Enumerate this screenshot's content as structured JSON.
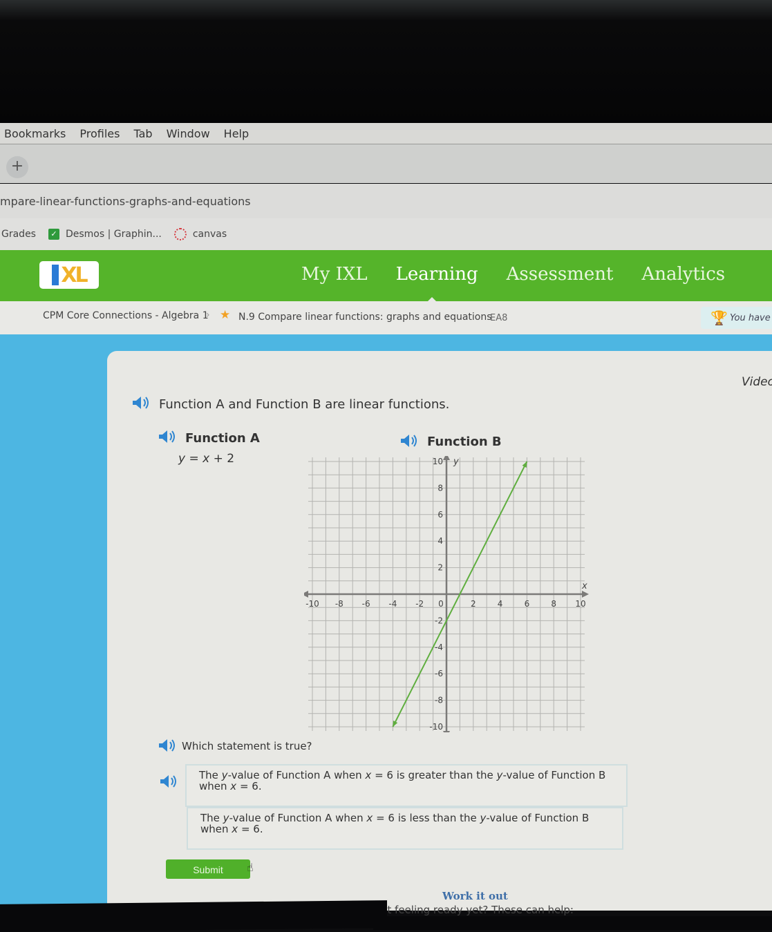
{
  "menubar": {
    "items": [
      "Bookmarks",
      "Profiles",
      "Tab",
      "Window",
      "Help"
    ]
  },
  "tabbar": {
    "new_tab_label": "+"
  },
  "address_bar": {
    "url": "mpare-linear-functions-graphs-and-equations"
  },
  "bookmarks": [
    {
      "label": "Grades",
      "icon": "none"
    },
    {
      "label": "Desmos | Graphin...",
      "icon": "desmos-icon"
    },
    {
      "label": "canvas",
      "icon": "canvas-icon"
    }
  ],
  "ixl_nav": {
    "logo": "IXL",
    "items": [
      "My IXL",
      "Learning",
      "Assessment",
      "Analytics"
    ],
    "active": "Learning"
  },
  "breadcrumb": {
    "course": "CPM Core Connections - Algebra 1",
    "skill": "N.9 Compare linear functions: graphs and equations",
    "code": "EA8",
    "award_text": "You have"
  },
  "card": {
    "video_link": "Video",
    "intro": "Function A and Function B are linear functions.",
    "function_a_label": "Function A",
    "function_a_eq": {
      "lhs": "y",
      "rhs_var": "x",
      "rhs_rest": " + 2"
    },
    "function_b_label": "Function B",
    "question": "Which statement is true?",
    "options": [
      {
        "pre": "The ",
        "v1": "y",
        "mid1": "-value of Function A when ",
        "v2": "x",
        "mid2": " = 6 is greater than the ",
        "v3": "y",
        "mid3": "-value of Function B when ",
        "v4": "x",
        "post": " = 6."
      },
      {
        "pre": "The ",
        "v1": "y",
        "mid1": "-value of Function A when ",
        "v2": "x",
        "mid2": " = 6 is less than the ",
        "v3": "y",
        "mid3": "-value of Function B when ",
        "v4": "x",
        "post": " = 6."
      }
    ],
    "submit_label": "Submit",
    "work_it_out": "Work it out",
    "not_ready": "Not feeling ready yet? These can help:"
  },
  "chart_data": {
    "type": "line",
    "title": "Function B",
    "xlabel": "x",
    "ylabel": "y",
    "xlim": [
      -10,
      10
    ],
    "ylim": [
      -10,
      10
    ],
    "x_ticks": [
      -10,
      -8,
      -6,
      -4,
      -2,
      0,
      2,
      4,
      6,
      8,
      10
    ],
    "y_ticks": [
      -10,
      -8,
      -6,
      -4,
      -2,
      2,
      4,
      6,
      8,
      10
    ],
    "grid": true,
    "grid_step": 1,
    "series": [
      {
        "name": "Function B",
        "x": [
          -4,
          6
        ],
        "y": [
          -10,
          10
        ],
        "equation": "y = 2x - 2",
        "color": "#5fae3f"
      }
    ]
  },
  "colors": {
    "ixl_green": "#55b42a",
    "sky_blue": "#4db6e2",
    "speaker_blue": "#2f86d1",
    "line_green": "#5fae3f"
  }
}
